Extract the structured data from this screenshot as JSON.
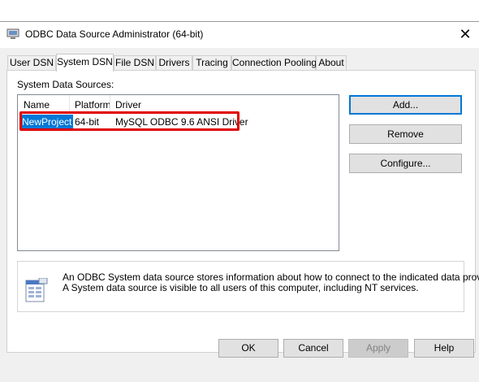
{
  "window": {
    "title": "ODBC Data Source Administrator (64-bit)",
    "close_glyph": "✕"
  },
  "tabs": [
    {
      "label": "User DSN"
    },
    {
      "label": "System DSN",
      "active": true
    },
    {
      "label": "File DSN"
    },
    {
      "label": "Drivers"
    },
    {
      "label": "Tracing"
    },
    {
      "label": "Connection Pooling"
    },
    {
      "label": "About"
    }
  ],
  "panel": {
    "group_label": "System Data Sources:",
    "columns": [
      "Name",
      "Platform",
      "Driver"
    ],
    "rows": [
      {
        "name": "NewProject",
        "platform": "64-bit",
        "driver": "MySQL ODBC 9.6 ANSI Driver",
        "selected": true
      }
    ],
    "buttons": {
      "add": "Add...",
      "remove": "Remove",
      "configure": "Configure..."
    },
    "info": {
      "line1": "An ODBC System data source stores information about how to connect to the indicated data provider.",
      "line2": "A System data source is visible to all users of this computer, including NT services."
    }
  },
  "footer": {
    "ok": "OK",
    "cancel": "Cancel",
    "apply": "Apply",
    "help": "Help"
  },
  "colors": {
    "selection": "#0078d7",
    "highlight_box": "#e00000"
  },
  "icons": {
    "title": "odbc-admin-icon",
    "info": "database-form-icon"
  }
}
